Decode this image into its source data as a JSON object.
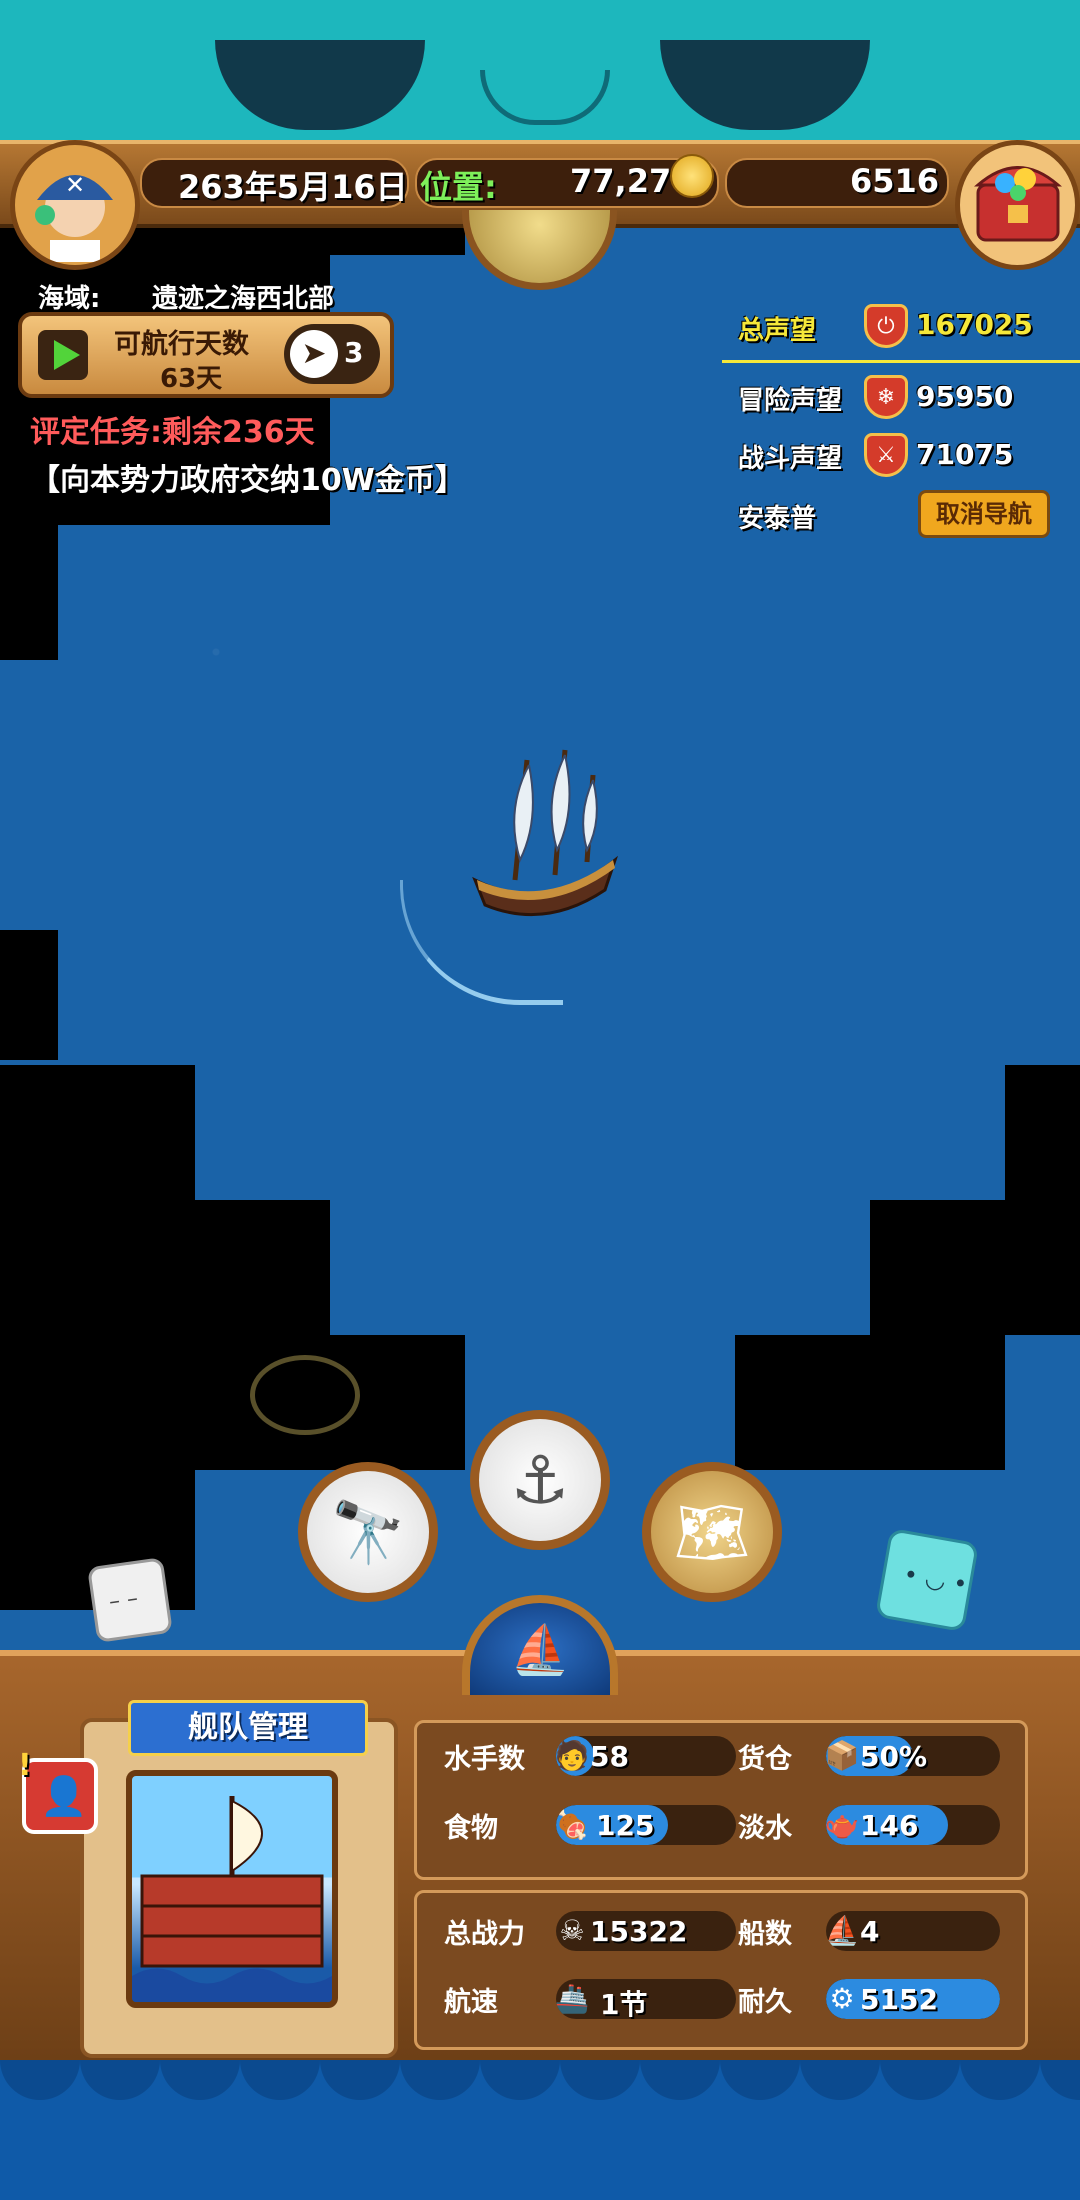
{
  "header": {
    "date": "263年5月16日",
    "position_label": "位置:",
    "position_value": "77,27",
    "gold": "6516"
  },
  "sea_area": {
    "label": "海域:",
    "value": "遗迹之海西北部"
  },
  "voyage": {
    "label": "可航行天数",
    "days": "63天",
    "navigate_count": "3"
  },
  "mission": {
    "title": "评定任务:",
    "remaining": "剩余236天",
    "desc": "【向本势力政府交纳10W金币】"
  },
  "reputation": {
    "total_label": "总声望",
    "total_value": "167025",
    "adventure_label": "冒险声望",
    "adventure_value": "95950",
    "battle_label": "战斗声望",
    "battle_value": "71075",
    "port_label": "安泰普",
    "cancel_nav_label": "取消导航"
  },
  "fleet": {
    "title": "舰队管理",
    "sailors_label": "水手数",
    "sailors_value": "58",
    "cargo_label": "货仓",
    "cargo_value": "50%",
    "food_label": "食物",
    "food_value": "125",
    "water_label": "淡水",
    "water_value": "146",
    "power_label": "总战力",
    "power_value": "15322",
    "ships_label": "船数",
    "ships_value": "4",
    "speed_label": "航速",
    "speed_value": "1节",
    "durability_label": "耐久",
    "durability_value": "5152",
    "cargo_fill": 0.5,
    "food_fill": 0.62,
    "water_fill": 0.7,
    "durability_fill": 1.0
  },
  "colors": {
    "sea": "#1a63a8",
    "mission_red": "#ff5b5b",
    "rep_yellow": "#f6e83a",
    "teal": "#1db7bd"
  },
  "icons": {
    "telescope": "telescope-icon",
    "anchor": "anchor-icon",
    "map": "world-map-icon",
    "ship": "ship-icon",
    "chest": "treasure-chest-icon"
  }
}
